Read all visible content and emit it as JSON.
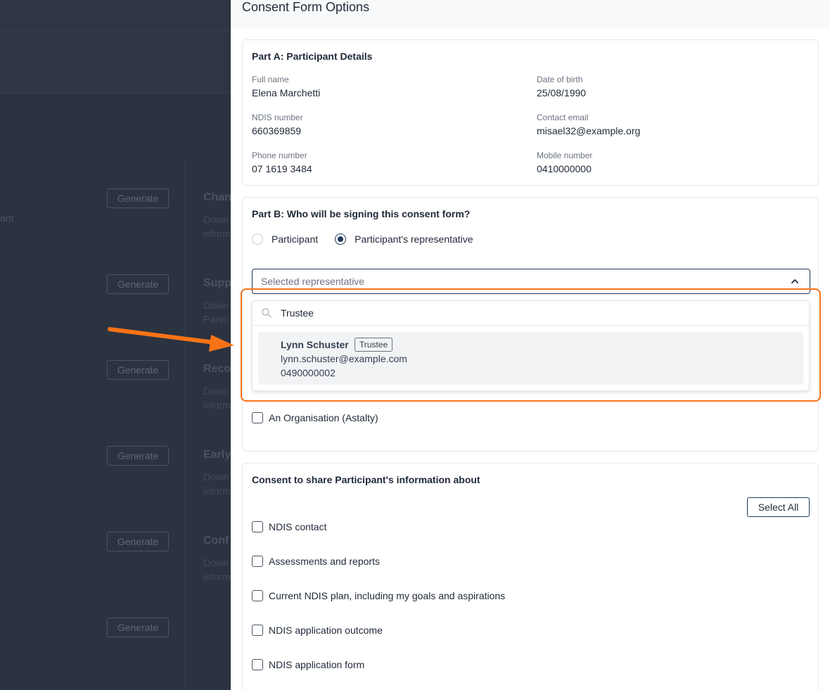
{
  "background": {
    "partial_text": "ant",
    "rows": [
      {
        "button": "Generate",
        "title": "Chan",
        "desc_lines": [
          "Down",
          "inform"
        ]
      },
      {
        "button": "Generate",
        "title": "Supp",
        "desc_lines": [
          "Down",
          "Partic"
        ]
      },
      {
        "button": "Generate",
        "title": "Reco",
        "desc_lines": [
          "Down",
          "inform"
        ]
      },
      {
        "button": "Generate",
        "title": "Early",
        "desc_lines": [
          "Down",
          "inform"
        ]
      },
      {
        "button": "Generate",
        "title": "Conf",
        "desc_lines": [
          "Down",
          "inform"
        ]
      },
      {
        "button": "Generate",
        "title": "",
        "desc_lines": [
          "",
          ""
        ]
      }
    ]
  },
  "drawer": {
    "title": "Consent Form Options"
  },
  "part_a": {
    "title": "Part A: Participant Details",
    "fields": {
      "full_name": {
        "label": "Full name",
        "value": "Elena Marchetti"
      },
      "dob": {
        "label": "Date of birth",
        "value": "25/08/1990"
      },
      "ndis": {
        "label": "NDIS number",
        "value": "660369859"
      },
      "email": {
        "label": "Contact email",
        "value": "misael32@example.org"
      },
      "phone": {
        "label": "Phone number",
        "value": "07 1619 3484"
      },
      "mobile": {
        "label": "Mobile number",
        "value": "0410000000"
      }
    }
  },
  "part_b": {
    "title": "Part B: Who will be signing this consent form?",
    "radio_participant": "Participant",
    "radio_representative": "Participant's representative",
    "selected": "representative",
    "select_placeholder": "Selected representative",
    "organisation_label": "An Organisation (Astalty)"
  },
  "dropdown": {
    "search_value": "Trustee",
    "option": {
      "name": "Lynn Schuster",
      "badge": "Trustee",
      "email": "lynn.schuster@example.com",
      "phone": "0490000002"
    }
  },
  "consent": {
    "title": "Consent to share Participant's information about",
    "select_all": "Select All",
    "items": [
      "NDIS contact",
      "Assessments and reports",
      "Current NDIS plan, including my goals and aspirations",
      "NDIS application outcome",
      "NDIS application form"
    ]
  },
  "colors": {
    "accent": "#1f3a5a",
    "annotation": "#f97316"
  }
}
